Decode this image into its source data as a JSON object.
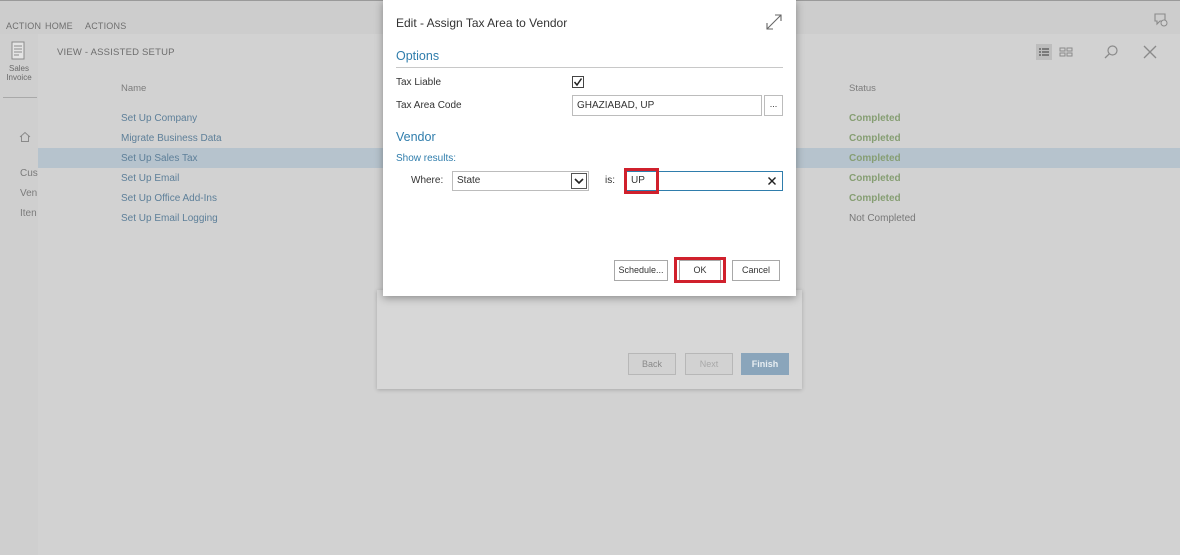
{
  "ribbon": {
    "tabs": [
      "ACTION",
      "HOME",
      "ACTIONS"
    ]
  },
  "left_pane": {
    "sales_invoice_label": "Sales Invoice",
    "items": [
      "Cus",
      "Ven",
      "Iten"
    ]
  },
  "page": {
    "view_title": "VIEW - ASSISTED SETUP",
    "columns": {
      "name": "Name",
      "status": "Status"
    },
    "rows": [
      {
        "name": "Set Up Company",
        "status": "Completed"
      },
      {
        "name": "Migrate Business Data",
        "status": "Completed"
      },
      {
        "name": "Set Up Sales Tax",
        "status": "Completed"
      },
      {
        "name": "Set Up Email",
        "status": "Completed"
      },
      {
        "name": "Set Up Office Add-Ins",
        "status": "Completed"
      },
      {
        "name": "Set Up Email Logging",
        "status": "Not Completed"
      }
    ]
  },
  "wizard": {
    "back": "Back",
    "next": "Next",
    "finish": "Finish"
  },
  "dialog": {
    "title": "Edit - Assign Tax Area to Vendor",
    "options_section": "Options",
    "tax_liable_label": "Tax Liable",
    "tax_liable_checked": true,
    "tax_area_code_label": "Tax Area Code",
    "tax_area_code_value": "GHAZIABAD, UP",
    "ellipsis": "...",
    "vendor_section": "Vendor",
    "show_results": "Show results:",
    "where_label": "Where:",
    "where_field": "State",
    "is_label": "is:",
    "filter_value": "UP",
    "schedule_button": "Schedule...",
    "ok_button": "OK",
    "cancel_button": "Cancel"
  },
  "colors": {
    "accent": "#2f7dac",
    "highlight": "#d0202c",
    "completed": "#869e73"
  }
}
